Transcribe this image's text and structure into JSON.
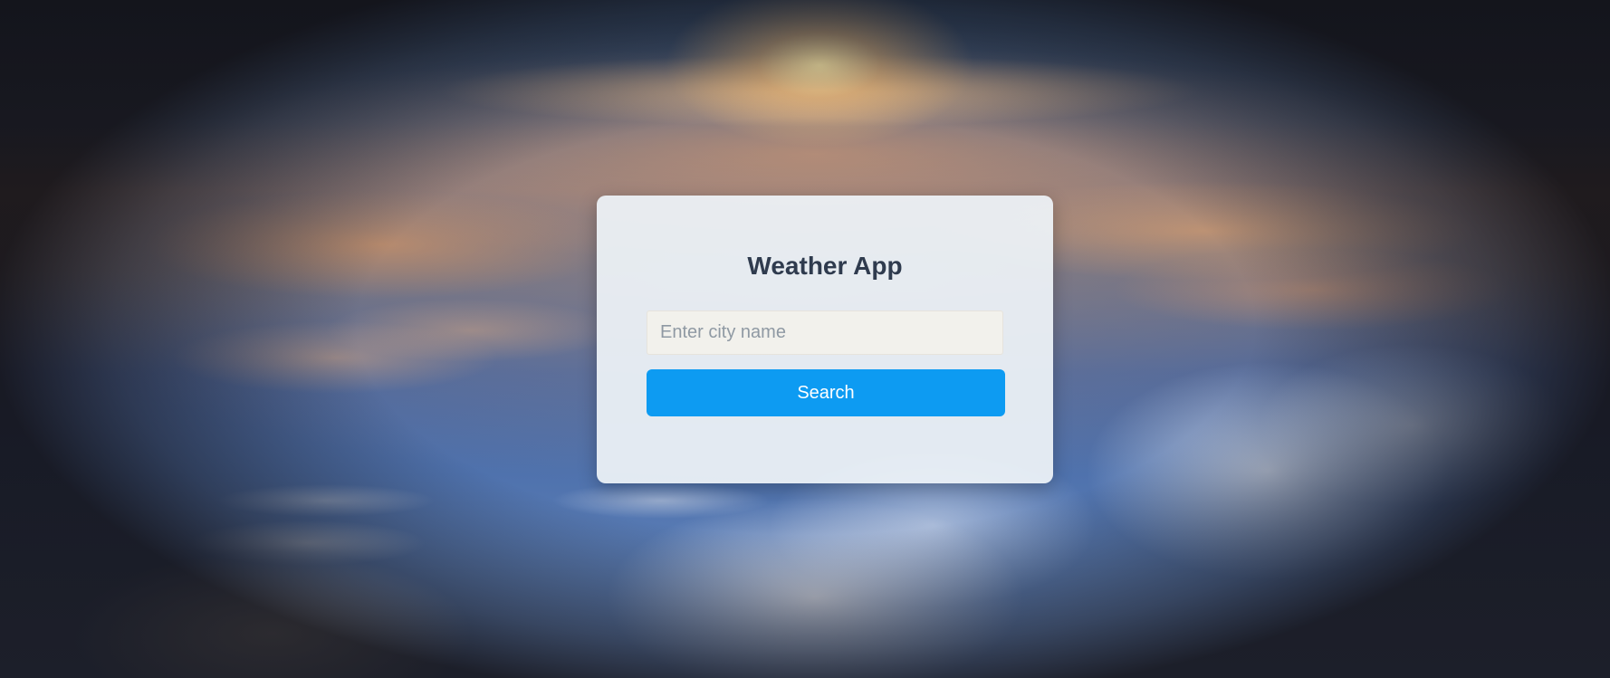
{
  "app": {
    "title": "Weather App"
  },
  "search": {
    "placeholder": "Enter city name",
    "value": "",
    "button_label": "Search"
  },
  "colors": {
    "button_background": "#0d9bf2",
    "button_text": "#ffffff",
    "card_background": "#eef3f8",
    "title_text": "#2f3b4e",
    "input_background": "#f2f1ec",
    "placeholder_text": "#8f99a3"
  }
}
